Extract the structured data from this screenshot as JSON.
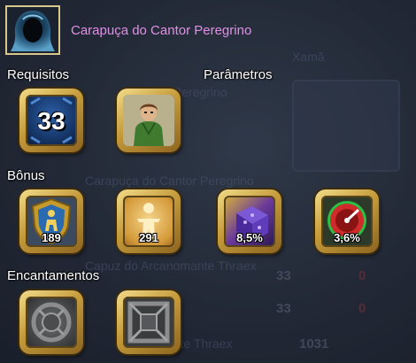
{
  "tooltip": {
    "item_name": "Carapuça do Cantor Peregrino",
    "item_icon": "hooded-cloak-icon",
    "sections": {
      "requirements": "Requisitos",
      "parameters": "Parâmetros",
      "bonus": "Bônus",
      "enchantments": "Encantamentos"
    },
    "requirement": {
      "level": "33",
      "icon": "level-badge-icon"
    },
    "parameter": {
      "icon": "character-portrait-icon"
    },
    "bonuses": [
      {
        "value": "189",
        "icon": "armor-shield-icon"
      },
      {
        "value": "291",
        "icon": "body-health-icon"
      },
      {
        "value": "8,5%",
        "icon": "spell-cube-icon"
      },
      {
        "value": "3,6%",
        "icon": "speed-gauge-icon"
      }
    ],
    "enchantments": [
      {
        "icon": "empty-round-rune-icon"
      },
      {
        "icon": "empty-square-rune-icon"
      }
    ],
    "colors": {
      "item_name": "#e090e6",
      "frame_gold": "#c49a3a"
    }
  },
  "background": {
    "texts": [
      "Capuz do Arcanomante Thraex",
      "Xamã",
      "Cantor Peregrino",
      "Carapuça do Cantor Peregrino",
      "Arcanomante Thraex",
      "33",
      "0",
      "1031"
    ]
  }
}
